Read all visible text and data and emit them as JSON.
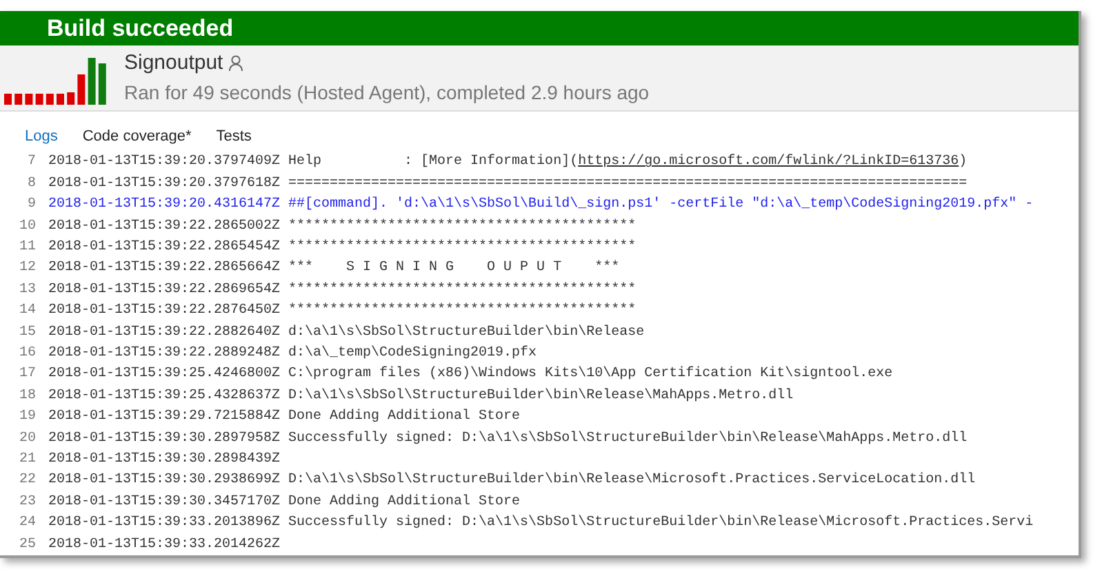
{
  "banner": {
    "title": "Build succeeded"
  },
  "build": {
    "name": "Signoutput",
    "summary": "Ran for 49 seconds (Hosted Agent), completed 2.9 hours ago"
  },
  "tabs": [
    {
      "label": "Logs",
      "selected": true
    },
    {
      "label": "Code coverage*",
      "selected": false
    },
    {
      "label": "Tests",
      "selected": false
    }
  ],
  "log": [
    {
      "number": "7",
      "timestamp": "2018-01-13T15:39:20.3797409Z",
      "kind": "help",
      "text": "Help          : [More Information](",
      "link": "https://go.microsoft.com/fwlink/?LinkID=613736",
      "suffix": ")"
    },
    {
      "number": "8",
      "timestamp": "2018-01-13T15:39:20.3797618Z",
      "kind": "plain",
      "text": "=================================================================================="
    },
    {
      "number": "9",
      "timestamp": "2018-01-13T15:39:20.4316147Z",
      "kind": "command",
      "text": "##[command]. 'd:\\a\\1\\s\\SbSol\\Build\\_sign.ps1' -certFile \"d:\\a\\_temp\\CodeSigning2019.pfx\" -"
    },
    {
      "number": "10",
      "timestamp": "2018-01-13T15:39:22.2865002Z",
      "kind": "plain",
      "text": "******************************************"
    },
    {
      "number": "11",
      "timestamp": "2018-01-13T15:39:22.2865454Z",
      "kind": "plain",
      "text": "******************************************"
    },
    {
      "number": "12",
      "timestamp": "2018-01-13T15:39:22.2865664Z",
      "kind": "plain",
      "text": "***    S I G N I N G    O U P U T    ***"
    },
    {
      "number": "13",
      "timestamp": "2018-01-13T15:39:22.2869654Z",
      "kind": "plain",
      "text": "******************************************"
    },
    {
      "number": "14",
      "timestamp": "2018-01-13T15:39:22.2876450Z",
      "kind": "plain",
      "text": "******************************************"
    },
    {
      "number": "15",
      "timestamp": "2018-01-13T15:39:22.2882640Z",
      "kind": "plain",
      "text": "d:\\a\\1\\s\\SbSol\\StructureBuilder\\bin\\Release"
    },
    {
      "number": "16",
      "timestamp": "2018-01-13T15:39:22.2889248Z",
      "kind": "plain",
      "text": "d:\\a\\_temp\\CodeSigning2019.pfx"
    },
    {
      "number": "17",
      "timestamp": "2018-01-13T15:39:25.4246800Z",
      "kind": "plain",
      "text": "C:\\program files (x86)\\Windows Kits\\10\\App Certification Kit\\signtool.exe"
    },
    {
      "number": "18",
      "timestamp": "2018-01-13T15:39:25.4328637Z",
      "kind": "plain",
      "text": "D:\\a\\1\\s\\SbSol\\StructureBuilder\\bin\\Release\\MahApps.Metro.dll"
    },
    {
      "number": "19",
      "timestamp": "2018-01-13T15:39:29.7215884Z",
      "kind": "plain",
      "text": "Done Adding Additional Store"
    },
    {
      "number": "20",
      "timestamp": "2018-01-13T15:39:30.2897958Z",
      "kind": "plain",
      "text": "Successfully signed: D:\\a\\1\\s\\SbSol\\StructureBuilder\\bin\\Release\\MahApps.Metro.dll"
    },
    {
      "number": "21",
      "timestamp": "2018-01-13T15:39:30.2898439Z",
      "kind": "plain"
    },
    {
      "number": "22",
      "timestamp": "2018-01-13T15:39:30.2938699Z",
      "kind": "plain",
      "text": "D:\\a\\1\\s\\SbSol\\StructureBuilder\\bin\\Release\\Microsoft.Practices.ServiceLocation.dll"
    },
    {
      "number": "23",
      "timestamp": "2018-01-13T15:39:30.3457170Z",
      "kind": "plain",
      "text": "Done Adding Additional Store"
    },
    {
      "number": "24",
      "timestamp": "2018-01-13T15:39:33.2013896Z",
      "kind": "plain",
      "text": "Successfully signed: D:\\a\\1\\s\\SbSol\\StructureBuilder\\bin\\Release\\Microsoft.Practices.Servi"
    },
    {
      "number": "25",
      "timestamp": "2018-01-13T15:39:33.2014262Z",
      "kind": "plain"
    }
  ]
}
